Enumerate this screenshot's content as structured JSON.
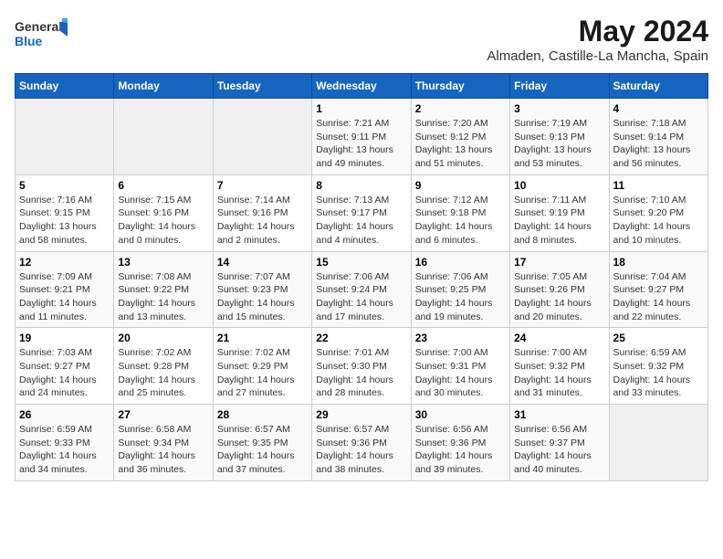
{
  "header": {
    "logo_general": "General",
    "logo_blue": "Blue",
    "title": "May 2024",
    "subtitle": "Almaden, Castille-La Mancha, Spain"
  },
  "weekdays": [
    "Sunday",
    "Monday",
    "Tuesday",
    "Wednesday",
    "Thursday",
    "Friday",
    "Saturday"
  ],
  "weeks": [
    [
      {
        "day": "",
        "info": ""
      },
      {
        "day": "",
        "info": ""
      },
      {
        "day": "",
        "info": ""
      },
      {
        "day": "1",
        "info": "Sunrise: 7:21 AM\nSunset: 9:11 PM\nDaylight: 13 hours\nand 49 minutes."
      },
      {
        "day": "2",
        "info": "Sunrise: 7:20 AM\nSunset: 9:12 PM\nDaylight: 13 hours\nand 51 minutes."
      },
      {
        "day": "3",
        "info": "Sunrise: 7:19 AM\nSunset: 9:13 PM\nDaylight: 13 hours\nand 53 minutes."
      },
      {
        "day": "4",
        "info": "Sunrise: 7:18 AM\nSunset: 9:14 PM\nDaylight: 13 hours\nand 56 minutes."
      }
    ],
    [
      {
        "day": "5",
        "info": "Sunrise: 7:16 AM\nSunset: 9:15 PM\nDaylight: 13 hours\nand 58 minutes."
      },
      {
        "day": "6",
        "info": "Sunrise: 7:15 AM\nSunset: 9:16 PM\nDaylight: 14 hours\nand 0 minutes."
      },
      {
        "day": "7",
        "info": "Sunrise: 7:14 AM\nSunset: 9:16 PM\nDaylight: 14 hours\nand 2 minutes."
      },
      {
        "day": "8",
        "info": "Sunrise: 7:13 AM\nSunset: 9:17 PM\nDaylight: 14 hours\nand 4 minutes."
      },
      {
        "day": "9",
        "info": "Sunrise: 7:12 AM\nSunset: 9:18 PM\nDaylight: 14 hours\nand 6 minutes."
      },
      {
        "day": "10",
        "info": "Sunrise: 7:11 AM\nSunset: 9:19 PM\nDaylight: 14 hours\nand 8 minutes."
      },
      {
        "day": "11",
        "info": "Sunrise: 7:10 AM\nSunset: 9:20 PM\nDaylight: 14 hours\nand 10 minutes."
      }
    ],
    [
      {
        "day": "12",
        "info": "Sunrise: 7:09 AM\nSunset: 9:21 PM\nDaylight: 14 hours\nand 11 minutes."
      },
      {
        "day": "13",
        "info": "Sunrise: 7:08 AM\nSunset: 9:22 PM\nDaylight: 14 hours\nand 13 minutes."
      },
      {
        "day": "14",
        "info": "Sunrise: 7:07 AM\nSunset: 9:23 PM\nDaylight: 14 hours\nand 15 minutes."
      },
      {
        "day": "15",
        "info": "Sunrise: 7:06 AM\nSunset: 9:24 PM\nDaylight: 14 hours\nand 17 minutes."
      },
      {
        "day": "16",
        "info": "Sunrise: 7:06 AM\nSunset: 9:25 PM\nDaylight: 14 hours\nand 19 minutes."
      },
      {
        "day": "17",
        "info": "Sunrise: 7:05 AM\nSunset: 9:26 PM\nDaylight: 14 hours\nand 20 minutes."
      },
      {
        "day": "18",
        "info": "Sunrise: 7:04 AM\nSunset: 9:27 PM\nDaylight: 14 hours\nand 22 minutes."
      }
    ],
    [
      {
        "day": "19",
        "info": "Sunrise: 7:03 AM\nSunset: 9:27 PM\nDaylight: 14 hours\nand 24 minutes."
      },
      {
        "day": "20",
        "info": "Sunrise: 7:02 AM\nSunset: 9:28 PM\nDaylight: 14 hours\nand 25 minutes."
      },
      {
        "day": "21",
        "info": "Sunrise: 7:02 AM\nSunset: 9:29 PM\nDaylight: 14 hours\nand 27 minutes."
      },
      {
        "day": "22",
        "info": "Sunrise: 7:01 AM\nSunset: 9:30 PM\nDaylight: 14 hours\nand 28 minutes."
      },
      {
        "day": "23",
        "info": "Sunrise: 7:00 AM\nSunset: 9:31 PM\nDaylight: 14 hours\nand 30 minutes."
      },
      {
        "day": "24",
        "info": "Sunrise: 7:00 AM\nSunset: 9:32 PM\nDaylight: 14 hours\nand 31 minutes."
      },
      {
        "day": "25",
        "info": "Sunrise: 6:59 AM\nSunset: 9:32 PM\nDaylight: 14 hours\nand 33 minutes."
      }
    ],
    [
      {
        "day": "26",
        "info": "Sunrise: 6:59 AM\nSunset: 9:33 PM\nDaylight: 14 hours\nand 34 minutes."
      },
      {
        "day": "27",
        "info": "Sunrise: 6:58 AM\nSunset: 9:34 PM\nDaylight: 14 hours\nand 36 minutes."
      },
      {
        "day": "28",
        "info": "Sunrise: 6:57 AM\nSunset: 9:35 PM\nDaylight: 14 hours\nand 37 minutes."
      },
      {
        "day": "29",
        "info": "Sunrise: 6:57 AM\nSunset: 9:36 PM\nDaylight: 14 hours\nand 38 minutes."
      },
      {
        "day": "30",
        "info": "Sunrise: 6:56 AM\nSunset: 9:36 PM\nDaylight: 14 hours\nand 39 minutes."
      },
      {
        "day": "31",
        "info": "Sunrise: 6:56 AM\nSunset: 9:37 PM\nDaylight: 14 hours\nand 40 minutes."
      },
      {
        "day": "",
        "info": ""
      }
    ]
  ]
}
